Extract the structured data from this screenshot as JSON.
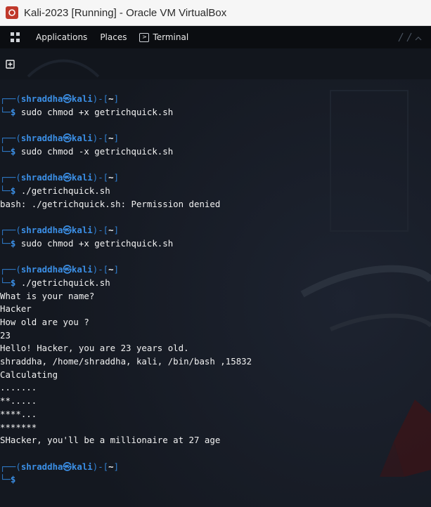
{
  "window": {
    "title": "Kali-2023 [Running] - Oracle VM VirtualBox"
  },
  "panel": {
    "applications_label": "Applications",
    "places_label": "Places",
    "terminal_label": "Terminal"
  },
  "prompt": {
    "user": "shraddha",
    "at_symbol": "㉿",
    "host": "kali",
    "path": "~",
    "symbol": "$"
  },
  "session": [
    {
      "type": "prompt",
      "cmd": "sudo chmod +x getrichquick.sh"
    },
    {
      "type": "prompt",
      "cmd": "sudo chmod -x getrichquick.sh"
    },
    {
      "type": "prompt",
      "cmd": "./getrichquick.sh"
    },
    {
      "type": "output",
      "text": "bash: ./getrichquick.sh: Permission denied"
    },
    {
      "type": "prompt",
      "cmd": "sudo chmod +x getrichquick.sh"
    },
    {
      "type": "prompt",
      "cmd": "./getrichquick.sh"
    },
    {
      "type": "output",
      "text": "What is your name?"
    },
    {
      "type": "output",
      "text": "Hacker"
    },
    {
      "type": "output",
      "text": "How old are you ?"
    },
    {
      "type": "output",
      "text": "23"
    },
    {
      "type": "output",
      "text": "Hello! Hacker, you are 23 years old."
    },
    {
      "type": "output",
      "text": "shraddha, /home/shraddha, kali, /bin/bash ,15832"
    },
    {
      "type": "output",
      "text": "Calculating"
    },
    {
      "type": "output",
      "text": "......."
    },
    {
      "type": "output",
      "text": "**....."
    },
    {
      "type": "output",
      "text": "****..."
    },
    {
      "type": "output",
      "text": "*******"
    },
    {
      "type": "output",
      "text": "SHacker, you'll be a millionaire at 27 age"
    },
    {
      "type": "prompt",
      "cmd": ""
    }
  ]
}
